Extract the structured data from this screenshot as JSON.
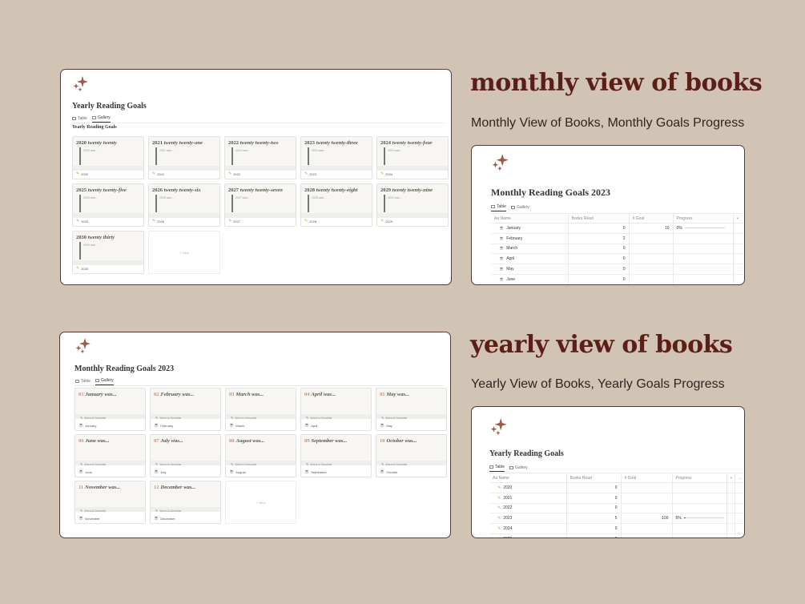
{
  "panel1": {
    "title": "Yearly Reading Goals",
    "tabs": [
      "Table",
      "Gallery"
    ],
    "section_label": "Yearly Reading Goals",
    "cards": [
      {
        "num": "2020",
        "words": "twenty twenty",
        "quote": "2020 was...",
        "tag": "2020"
      },
      {
        "num": "2021",
        "words": "twenty twenty-one",
        "quote": "2021 was...",
        "tag": "2021"
      },
      {
        "num": "2022",
        "words": "twenty twenty-two",
        "quote": "2022 was...",
        "tag": "2022"
      },
      {
        "num": "2023",
        "words": "twenty twenty-three",
        "quote": "2023 was...",
        "tag": "2023"
      },
      {
        "num": "2024",
        "words": "twenty twenty-four",
        "quote": "2024 was...",
        "tag": "2024"
      },
      {
        "num": "2025",
        "words": "twenty twenty-five",
        "quote": "2025 was...",
        "tag": "2025"
      },
      {
        "num": "2026",
        "words": "twenty twenty-six",
        "quote": "2026 was...",
        "tag": "2026"
      },
      {
        "num": "2027",
        "words": "twenty twenty-seven",
        "quote": "2027 was...",
        "tag": "2027"
      },
      {
        "num": "2028",
        "words": "twenty twenty-eight",
        "quote": "2028 was...",
        "tag": "2028"
      },
      {
        "num": "2029",
        "words": "twenty twenty-nine",
        "quote": "2029 was...",
        "tag": "2029"
      },
      {
        "num": "2030",
        "words": "twenty thirty",
        "quote": "2030 was...",
        "tag": "2030"
      }
    ],
    "new_label": "+ New"
  },
  "heading_top": "monthly view of books",
  "sub_top": "Monthly View of Books, Monthly Goals Progress",
  "panel2": {
    "title": "Monthly Reading Goals 2023",
    "tabs": [
      "Table",
      "Gallery"
    ],
    "headers": [
      "Aa Name",
      "Books Read",
      "# Goal",
      "Progress",
      "+"
    ],
    "rows": [
      {
        "name": "January",
        "read": "0",
        "goal": "10",
        "progress": "0%"
      },
      {
        "name": "February",
        "read": "2",
        "goal": "",
        "progress": ""
      },
      {
        "name": "March",
        "read": "0",
        "goal": "",
        "progress": ""
      },
      {
        "name": "April",
        "read": "0",
        "goal": "",
        "progress": ""
      },
      {
        "name": "May",
        "read": "0",
        "goal": "",
        "progress": ""
      },
      {
        "name": "June",
        "read": "0",
        "goal": "",
        "progress": ""
      }
    ],
    "progress_levels": [
      0
    ]
  },
  "panel3": {
    "title": "Monthly Reading Goals 2023",
    "tabs": [
      "Table",
      "Gallery"
    ],
    "cards": [
      {
        "num": "01",
        "label": "January was...",
        "tag": "January"
      },
      {
        "num": "02",
        "label": "February was...",
        "tag": "February"
      },
      {
        "num": "03",
        "label": "March was...",
        "tag": "March"
      },
      {
        "num": "04",
        "label": "April was...",
        "tag": "April"
      },
      {
        "num": "05",
        "label": "May was...",
        "tag": "May"
      },
      {
        "num": "06",
        "label": "June was...",
        "tag": "June"
      },
      {
        "num": "07",
        "label": "July was...",
        "tag": "July"
      },
      {
        "num": "08",
        "label": "August was...",
        "tag": "August"
      },
      {
        "num": "09",
        "label": "September was...",
        "tag": "September"
      },
      {
        "num": "10",
        "label": "October was...",
        "tag": "October"
      },
      {
        "num": "11",
        "label": "November was...",
        "tag": "November"
      },
      {
        "num": "12",
        "label": "December was...",
        "tag": "December"
      }
    ],
    "word_label": "Word to Describe",
    "new_label": "+ New"
  },
  "heading_bottom": "yearly view of books",
  "sub_bottom": "Yearly View of Books, Yearly Goals Progress",
  "panel4": {
    "title": "Yearly Reading Goals",
    "tabs": [
      "Table",
      "Gallery"
    ],
    "headers": [
      "Aa Name",
      "Books Read",
      "# Goal",
      "Progress",
      "+",
      "..."
    ],
    "rows": [
      {
        "name": "2020",
        "read": "0",
        "goal": "",
        "progress": ""
      },
      {
        "name": "2021",
        "read": "0",
        "goal": "",
        "progress": ""
      },
      {
        "name": "2022",
        "read": "0",
        "goal": "",
        "progress": ""
      },
      {
        "name": "2023",
        "read": "5",
        "goal": "100",
        "progress": "5%"
      },
      {
        "name": "2024",
        "read": "0",
        "goal": "",
        "progress": ""
      },
      {
        "name": "2025",
        "read": "0",
        "goal": "",
        "progress": ""
      }
    ],
    "progress_levels": [
      0.05
    ]
  },
  "colors": {
    "background": "#d2c4b5",
    "heading": "#5c1f17",
    "accent": "#9b5a45",
    "border": "#5a3b30"
  },
  "icons": {
    "sparkle": "sparkle-icon",
    "pencil": "pencil-icon",
    "cup": "coffee-cup-icon"
  }
}
